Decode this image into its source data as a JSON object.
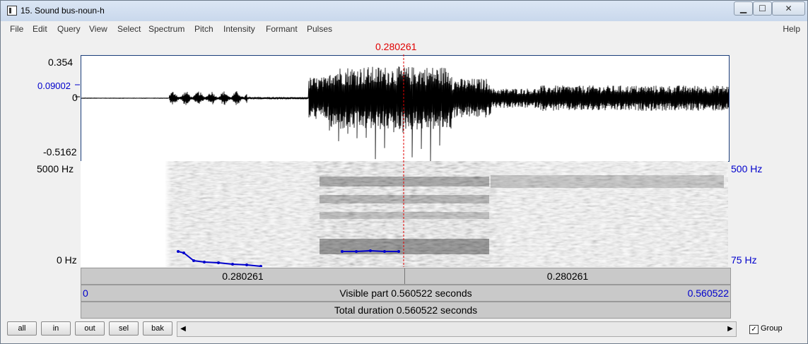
{
  "window": {
    "title": "15. Sound bus-noun-h"
  },
  "menu": [
    "File",
    "Edit",
    "Query",
    "View",
    "Select",
    "Spectrum",
    "Pitch",
    "Intensity",
    "Formant",
    "Pulses"
  ],
  "menu_help": "Help",
  "cursor_time": "0.280261",
  "waveform": {
    "y_max": "0.354",
    "y_cursor": "0.09002",
    "y_zero": "0",
    "y_min": "-0.5162"
  },
  "spectrogram": {
    "freq_top": "5000 Hz",
    "freq_bottom": "0 Hz",
    "pitch_top": "500 Hz",
    "pitch_bottom": "75 Hz"
  },
  "time_bar": {
    "left_segment": "0.280261",
    "right_segment": "0.280261",
    "visible_start": "0",
    "visible_label": "Visible part 0.560522 seconds",
    "visible_end": "0.560522",
    "total_label": "Total duration 0.560522 seconds"
  },
  "buttons": {
    "all": "all",
    "in": "in",
    "out": "out",
    "sel": "sel",
    "bak": "bak"
  },
  "group": {
    "label": "Group",
    "checked": "✓"
  },
  "colors": {
    "cursor": "#e00000",
    "pitch": "#0000cc",
    "waveform": "#000000"
  }
}
